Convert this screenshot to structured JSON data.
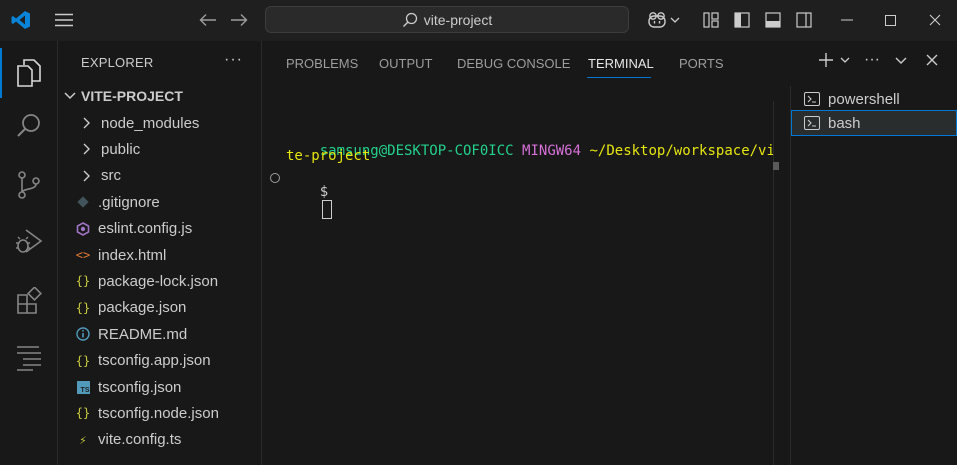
{
  "titlebar": {
    "search_text": "vite-project",
    "icons": [
      "vscode-logo-icon",
      "menu-icon",
      "back-arrow-icon",
      "forward-arrow-icon",
      "search-icon",
      "copilot-icon",
      "chevron-down-icon",
      "customize-layout-icon",
      "toggle-primary-sidebar-icon",
      "toggle-panel-icon",
      "toggle-secondary-sidebar-icon",
      "minimize-icon",
      "maximize-icon",
      "close-icon"
    ]
  },
  "activity_bar": [
    "explorer-icon",
    "search-icon",
    "source-control-icon",
    "run-debug-icon",
    "extensions-icon",
    "outline-icon"
  ],
  "explorer": {
    "title": "EXPLORER",
    "more": "···",
    "project": "VITE-PROJECT",
    "items": [
      {
        "label": "node_modules",
        "kind": "folder"
      },
      {
        "label": "public",
        "kind": "folder"
      },
      {
        "label": "src",
        "kind": "folder"
      },
      {
        "label": ".gitignore",
        "kind": "git",
        "icon": "git-diamond-icon"
      },
      {
        "label": "eslint.config.js",
        "kind": "eslint",
        "icon": "eslint-hexagon-icon"
      },
      {
        "label": "index.html",
        "kind": "html",
        "icon": "html-brackets-icon",
        "glyph": "<>"
      },
      {
        "label": "package-lock.json",
        "kind": "json",
        "icon": "json-braces-icon",
        "glyph": "{}"
      },
      {
        "label": "package.json",
        "kind": "json",
        "icon": "json-braces-icon",
        "glyph": "{}"
      },
      {
        "label": "README.md",
        "kind": "info",
        "icon": "info-icon",
        "glyph": "i"
      },
      {
        "label": "tsconfig.app.json",
        "kind": "json",
        "icon": "json-braces-icon",
        "glyph": "{}"
      },
      {
        "label": "tsconfig.json",
        "kind": "ts",
        "icon": "typescript-icon",
        "glyph": "TS"
      },
      {
        "label": "tsconfig.node.json",
        "kind": "json",
        "icon": "json-braces-icon",
        "glyph": "{}"
      },
      {
        "label": "vite.config.ts",
        "kind": "vite",
        "icon": "vite-bolt-icon",
        "glyph": "⚡"
      }
    ]
  },
  "panel": {
    "tabs": [
      "PROBLEMS",
      "OUTPUT",
      "DEBUG CONSOLE",
      "TERMINAL",
      "PORTS"
    ],
    "active_tab": "TERMINAL",
    "actions": [
      "plus-icon",
      "chevron-down-icon",
      "more-icon",
      "collapse-icon",
      "close-icon"
    ]
  },
  "terminal": {
    "user_host": "samsung@DESKTOP-COF0ICC",
    "shell": "MINGW64",
    "path_part1": "~/Desktop/workspace/vi",
    "path_part2": "te-project",
    "prompt": "$"
  },
  "terminal_list": [
    {
      "label": "powershell",
      "selected": false
    },
    {
      "label": "bash",
      "selected": true
    }
  ],
  "colors": {
    "accent": "#0078d4",
    "user_host": "#23d18b",
    "shell": "#d670d6",
    "path": "#e5e510",
    "json_icon": "#cbcb41",
    "html_icon": "#e37933",
    "eslint_icon": "#a074c4",
    "info_icon": "#519aba",
    "ts_icon": "#519aba",
    "git_icon": "#41535b",
    "vite_icon": "#cbcb41"
  }
}
